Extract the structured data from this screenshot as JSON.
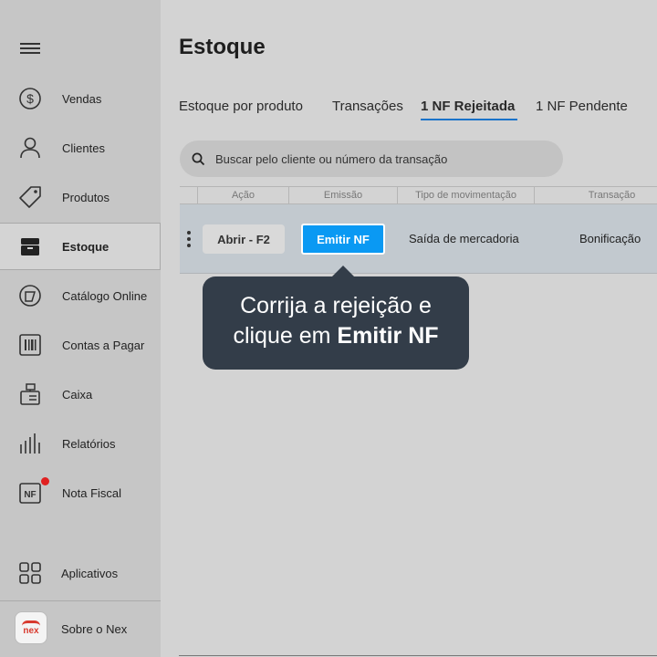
{
  "sidebar": {
    "menu_icon": "hamburger-icon",
    "items": [
      {
        "label": "Vendas",
        "icon": "dollar-circle-icon"
      },
      {
        "label": "Clientes",
        "icon": "user-icon"
      },
      {
        "label": "Produtos",
        "icon": "tag-icon"
      },
      {
        "label": "Estoque",
        "icon": "box-icon",
        "active": true
      },
      {
        "label": "Catálogo Online",
        "icon": "catalog-icon"
      },
      {
        "label": "Contas a Pagar",
        "icon": "barcode-icon"
      },
      {
        "label": "Caixa",
        "icon": "cash-register-icon"
      },
      {
        "label": "Relatórios",
        "icon": "bar-chart-icon"
      },
      {
        "label": "Nota Fiscal",
        "icon": "nf-icon",
        "badge_color": "#e02020"
      }
    ],
    "apps_label": "Aplicativos",
    "about_label": "Sobre o Nex",
    "logo_text": "nex"
  },
  "main": {
    "title": "Estoque",
    "tabs": [
      {
        "label": "Estoque por produto"
      },
      {
        "label": "Transações"
      },
      {
        "label": "1 NF Rejeitada",
        "active": true
      },
      {
        "label": "1 NF Pendente"
      }
    ],
    "search": {
      "placeholder": "Buscar pelo cliente ou número da transação"
    },
    "table": {
      "headers": [
        "Ação",
        "Emissão",
        "Tipo de movimentação",
        "Transação"
      ],
      "rows": [
        {
          "action": "Abrir - F2",
          "emission": "Emitir NF",
          "movement_type": "Saída de mercadoria",
          "transaction": "Bonificação"
        }
      ]
    },
    "tooltip": {
      "line1": "Corrija a rejeição e",
      "line2_prefix": "clique em ",
      "line2_bold": "Emitir NF"
    }
  },
  "colors": {
    "accent": "#0a99f3",
    "tab_underline": "#1a73c9",
    "tooltip_bg": "#333d49",
    "brand": "#d83a2e"
  }
}
